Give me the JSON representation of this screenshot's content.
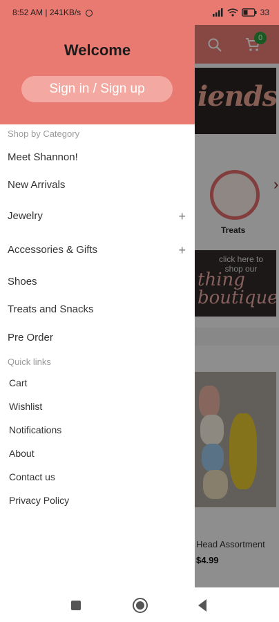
{
  "status_bar": {
    "time_info": "8:52 AM | 241KB/s",
    "battery": "33"
  },
  "drawer": {
    "title": "Welcome",
    "sign_in_label": "Sign in / Sign up",
    "categories_label": "Shop by Category",
    "categories": [
      {
        "label": "Meet Shannon!"
      },
      {
        "label": "New Arrivals"
      },
      {
        "label": "Jewelry",
        "expand_icon": "+"
      },
      {
        "label": "Accessories & Gifts",
        "expand_icon": "+"
      },
      {
        "label": "Shoes"
      },
      {
        "label": "Treats and Snacks"
      },
      {
        "label": "Pre Order"
      }
    ],
    "quick_links_label": "Quick links",
    "quick_links": [
      {
        "label": "Cart"
      },
      {
        "label": "Wishlist"
      },
      {
        "label": "Notifications"
      },
      {
        "label": "About"
      },
      {
        "label": "Contact us"
      },
      {
        "label": "Privacy Policy"
      }
    ]
  },
  "background": {
    "cart_count": "0",
    "banner1_text": "iends!",
    "treats_label": "Treats",
    "banner2_small": "click here to shop our",
    "banner2_big": "thing boutique!",
    "product_title": "Head Assortment",
    "product_price": "$4.99"
  },
  "colors": {
    "accent": "#e87a72",
    "sign_in_button": "#f3a9a1",
    "badge": "#2e9b3b"
  },
  "icons": {
    "search": "search-icon",
    "cart": "cart-icon",
    "expand": "plus-icon",
    "nav_recents": "square-icon",
    "nav_home": "circle-icon",
    "nav_back": "triangle-back-icon"
  }
}
